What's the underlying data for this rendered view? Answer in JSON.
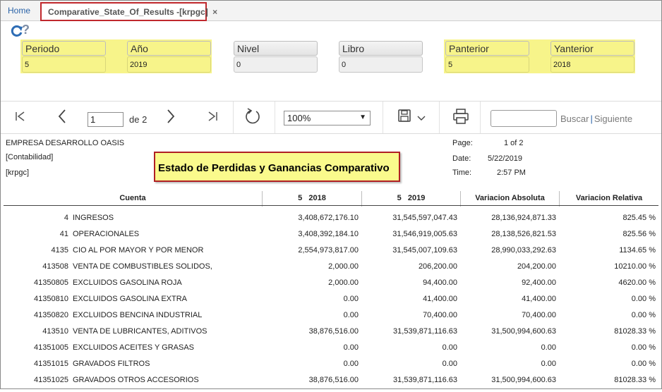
{
  "tabs": {
    "home": "Home",
    "active": "Comparative_State_Of_Results -[krpgc]",
    "close": "×"
  },
  "toolbar_icons": {
    "refresh": "refresh-icon",
    "help": "?"
  },
  "params": [
    {
      "label": "Periodo",
      "value": "5"
    },
    {
      "label": "Año",
      "value": "2019"
    },
    {
      "label": "Nivel",
      "value": "0"
    },
    {
      "label": "Libro",
      "value": "0"
    },
    {
      "label": "Panterior",
      "value": "5"
    },
    {
      "label": "Yanterior",
      "value": "2018"
    }
  ],
  "viewer": {
    "page": "1",
    "of_pages": "de 2",
    "zoom": "100%",
    "search_placeholder": "",
    "search_label": "Buscar",
    "search_sep": "|",
    "next_label": "Siguiente"
  },
  "report": {
    "company": "EMPRESA DESARROLLO OASIS",
    "module": "[Contabilidad]",
    "code": "[krpgc]",
    "title": "Estado de Perdidas y Ganancias Comparativo",
    "page_label": "Page:",
    "page_value": "1 of 2",
    "date_label": "Date:",
    "date_value": "5/22/2019",
    "time_label": "Time:",
    "time_value": "2:57 PM"
  },
  "table": {
    "headers": [
      "Cuenta",
      "5   2018",
      "5   2019",
      "Variacion Absoluta",
      "Variacion Relativa"
    ],
    "rows": [
      [
        "4",
        "INGRESOS",
        "3,408,672,176.10",
        "31,545,597,047.43",
        "28,136,924,871.33",
        "825.45 %"
      ],
      [
        "41",
        "OPERACIONALES",
        "3,408,392,184.10",
        "31,546,919,005.63",
        "28,138,526,821.53",
        "825.56 %"
      ],
      [
        "4135",
        "CIO AL POR MAYOR Y POR MENOR",
        "2,554,973,817.00",
        "31,545,007,109.63",
        "28,990,033,292.63",
        "1134.65 %"
      ],
      [
        "413508",
        "VENTA DE COMBUSTIBLES SOLIDOS,",
        "2,000.00",
        "206,200.00",
        "204,200.00",
        "10210.00 %"
      ],
      [
        "41350805",
        "EXCLUIDOS GASOLINA ROJA",
        "2,000.00",
        "94,400.00",
        "92,400.00",
        "4620.00 %"
      ],
      [
        "41350810",
        "EXCLUIDOS GASOLINA EXTRA",
        "0.00",
        "41,400.00",
        "41,400.00",
        "0.00 %"
      ],
      [
        "41350820",
        "EXCLUIDOS BENCINA INDUSTRIAL",
        "0.00",
        "70,400.00",
        "70,400.00",
        "0.00 %"
      ],
      [
        "413510",
        "VENTA DE LUBRICANTES, ADITIVOS",
        "38,876,516.00",
        "31,539,871,116.63",
        "31,500,994,600.63",
        "81028.33 %"
      ],
      [
        "41351005",
        "EXCLUIDOS ACEITES Y GRASAS",
        "0.00",
        "0.00",
        "0.00",
        "0.00 %"
      ],
      [
        "41351015",
        "GRAVADOS FILTROS",
        "0.00",
        "0.00",
        "0.00",
        "0.00 %"
      ],
      [
        "41351025",
        "GRAVADOS OTROS ACCESORIOS",
        "38,876,516.00",
        "31,539,871,116.63",
        "31,500,994,600.63",
        "81028.33 %"
      ]
    ]
  },
  "colors": {
    "highlight_yellow": "#f7f48a",
    "title_border": "#b01f24",
    "link_blue": "#2a63a8"
  }
}
